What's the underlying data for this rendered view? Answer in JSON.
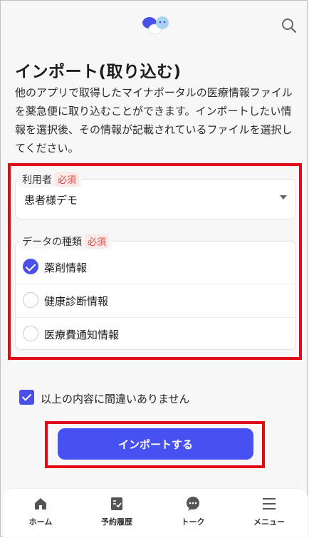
{
  "header": {
    "logo_icon": "app-logo-icon",
    "search_icon": "search-icon"
  },
  "page": {
    "title": "インポート(取り込む)",
    "description": "他のアプリで取得したマイナポータルの医療情報ファイルを薬急便に取り込むことができます。インポートしたい情報を選択後、その情報が記載されているファイルを選択してください。"
  },
  "form": {
    "user_label": "利用者",
    "required_badge": "必須",
    "user_value": "患者様デモ",
    "data_type_label": "データの種類",
    "options": [
      {
        "label": "薬剤情報",
        "checked": true
      },
      {
        "label": "健康診断情報",
        "checked": false
      },
      {
        "label": "医療費通知情報",
        "checked": false
      }
    ],
    "confirm_label": "以上の内容に間違いありません",
    "confirm_checked": true,
    "submit_label": "インポートする"
  },
  "nav": {
    "items": [
      {
        "label": "ホーム",
        "icon": "home-icon"
      },
      {
        "label": "予約履歴",
        "icon": "reservation-history-icon"
      },
      {
        "label": "トーク",
        "icon": "chat-icon"
      },
      {
        "label": "メニュー",
        "icon": "menu-icon"
      }
    ]
  },
  "colors": {
    "accent": "#4750f0",
    "required": "#e0463f",
    "highlight": "#e10a16"
  }
}
